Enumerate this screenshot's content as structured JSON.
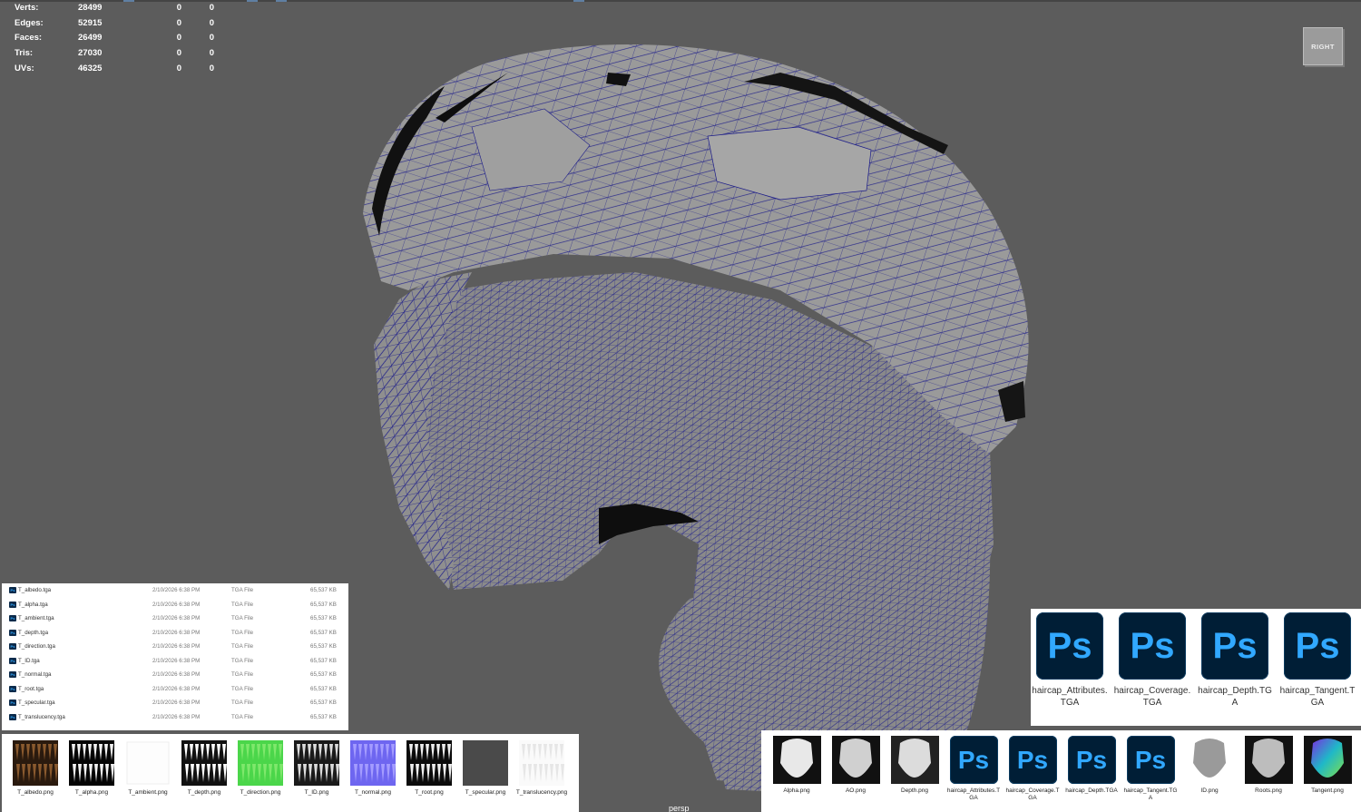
{
  "hud": {
    "rows": [
      {
        "label": "Verts:",
        "v1": "28499",
        "v2": "0",
        "v3": "0"
      },
      {
        "label": "Edges:",
        "v1": "52915",
        "v2": "0",
        "v3": "0"
      },
      {
        "label": "Faces:",
        "v1": "26499",
        "v2": "0",
        "v3": "0"
      },
      {
        "label": "Tris:",
        "v1": "27030",
        "v2": "0",
        "v3": "0"
      },
      {
        "label": "UVs:",
        "v1": "46325",
        "v2": "0",
        "v3": "0"
      }
    ]
  },
  "viewcube": {
    "label": "RIGHT"
  },
  "camera": {
    "label": "persp"
  },
  "colors": {
    "viewport_bg": "#5c5c5c",
    "mesh_fill": "#8e8e8e",
    "wire": "#1c1c8a",
    "ps_bg": "#001e36",
    "ps_text": "#31a8ff"
  },
  "file_list": {
    "rows": [
      {
        "name": "T_albedo.tga",
        "date": "2/10/2026 6:38 PM",
        "type": "TGA File",
        "size": "65,537 KB"
      },
      {
        "name": "T_alpha.tga",
        "date": "2/10/2026 6:38 PM",
        "type": "TGA File",
        "size": "65,537 KB"
      },
      {
        "name": "T_ambient.tga",
        "date": "2/10/2026 6:38 PM",
        "type": "TGA File",
        "size": "65,537 KB"
      },
      {
        "name": "T_depth.tga",
        "date": "2/10/2026 6:38 PM",
        "type": "TGA File",
        "size": "65,537 KB"
      },
      {
        "name": "T_direction.tga",
        "date": "2/10/2026 6:38 PM",
        "type": "TGA File",
        "size": "65,537 KB"
      },
      {
        "name": "T_ID.tga",
        "date": "2/10/2026 6:38 PM",
        "type": "TGA File",
        "size": "65,537 KB"
      },
      {
        "name": "T_normal.tga",
        "date": "2/10/2026 6:38 PM",
        "type": "TGA File",
        "size": "65,537 KB"
      },
      {
        "name": "T_root.tga",
        "date": "2/10/2026 6:38 PM",
        "type": "TGA File",
        "size": "65,537 KB"
      },
      {
        "name": "T_specular.tga",
        "date": "2/10/2026 6:38 PM",
        "type": "TGA File",
        "size": "65,537 KB"
      },
      {
        "name": "T_translucency.tga",
        "date": "2/10/2026 6:38 PM",
        "type": "TGA File",
        "size": "65,537 KB"
      }
    ]
  },
  "thumbnails": [
    {
      "name": "T_albedo.png",
      "icon": "albedo-thumbnail"
    },
    {
      "name": "T_alpha.png",
      "icon": "alpha-thumbnail"
    },
    {
      "name": "T_ambient.png",
      "icon": "ambient-thumbnail"
    },
    {
      "name": "T_depth.png",
      "icon": "depth-thumbnail"
    },
    {
      "name": "T_direction.png",
      "icon": "direction-thumbnail"
    },
    {
      "name": "T_ID.png",
      "icon": "id-thumbnail"
    },
    {
      "name": "T_normal.png",
      "icon": "normal-thumbnail"
    },
    {
      "name": "T_root.png",
      "icon": "root-thumbnail"
    },
    {
      "name": "T_specular.png",
      "icon": "specular-thumbnail"
    },
    {
      "name": "T_translucency.png",
      "icon": "translucency-thumbnail"
    }
  ],
  "ps_files": [
    {
      "name": "haircap_Attributes.TGA",
      "icon_text": "Ps"
    },
    {
      "name": "haircap_Coverage.TGA",
      "icon_text": "Ps"
    },
    {
      "name": "haircap_Depth.TGA",
      "icon_text": "Ps"
    },
    {
      "name": "haircap_Tangent.TGA",
      "icon_text": "Ps"
    }
  ],
  "bottom_strip": [
    {
      "name": "Alpha.png",
      "kind": "image"
    },
    {
      "name": "AO.png",
      "kind": "image"
    },
    {
      "name": "Depth.png",
      "kind": "image"
    },
    {
      "name": "haircap_Attributes.TGA",
      "kind": "ps",
      "icon_text": "Ps"
    },
    {
      "name": "haircap_Coverage.TGA",
      "kind": "ps",
      "icon_text": "Ps"
    },
    {
      "name": "haircap_Depth.TGA",
      "kind": "ps",
      "icon_text": "Ps"
    },
    {
      "name": "haircap_Tangent.TGA",
      "kind": "ps",
      "icon_text": "Ps"
    },
    {
      "name": "ID.png",
      "kind": "image"
    },
    {
      "name": "Roots.png",
      "kind": "image"
    },
    {
      "name": "Tangent.png",
      "kind": "image"
    }
  ]
}
